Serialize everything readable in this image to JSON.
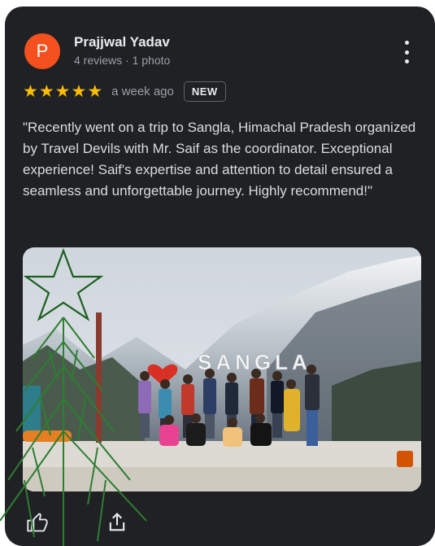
{
  "review": {
    "avatar_letter": "P",
    "author": "Prajjwal Yadav",
    "author_meta": "4 reviews · 1 photo",
    "stars": [
      "★",
      "★",
      "★",
      "★",
      "★"
    ],
    "time_ago": "a week ago",
    "badge": "NEW",
    "text": "\"Recently went on a trip to Sangla, Himachal Pradesh organized by Travel Devils with Mr. Saif as the coordinator. Exceptional experience! Saif's expertise and attention to detail ensured a seamless and unforgettable journey. Highly recommend!\"",
    "photo_sign": "SANGLA"
  },
  "icons": {
    "more": "more-vert-icon",
    "like": "thumbs-up-icon",
    "share": "share-icon",
    "heart": "heart-icon"
  },
  "colors": {
    "card_bg": "#202124",
    "avatar": "#f4511e",
    "star": "#fbbc04",
    "heart": "#d93025",
    "tree": "#2e7d32"
  }
}
